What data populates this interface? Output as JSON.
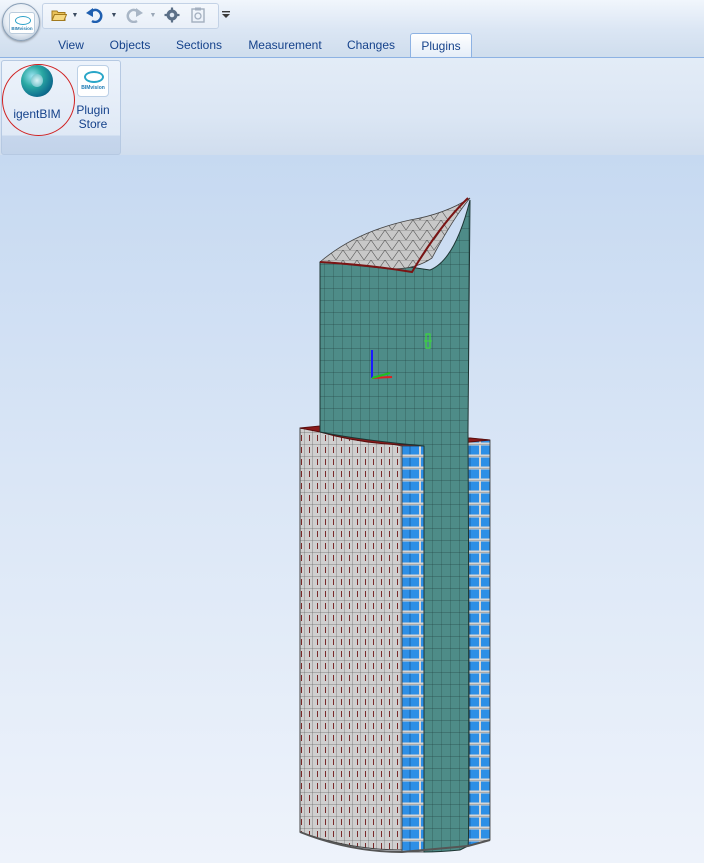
{
  "app": {
    "logo_text": "BIMvision",
    "quick_access": {
      "open_icon": "folder-open-icon",
      "undo_icon": "undo-icon",
      "redo_icon": "redo-icon",
      "settings_icon": "gear-icon",
      "disabled_icon": "clipboard-icon",
      "customize_icon": "chevron-down-icon"
    }
  },
  "tabs": [
    {
      "label": "View"
    },
    {
      "label": "Objects"
    },
    {
      "label": "Sections"
    },
    {
      "label": "Measurement"
    },
    {
      "label": "Changes"
    },
    {
      "label": "Plugins",
      "active": true
    }
  ],
  "ribbon": {
    "igentbim_label": "igentBIM",
    "plugin_store_label_1": "Plugin",
    "plugin_store_label_2": "Store",
    "plugin_store_icon_text": "BIMvision"
  },
  "viewport": {
    "background_top": "#c6d9f1",
    "background_bottom": "#eef3fb",
    "tower_glass": "#4f8f8a",
    "facade_stone": "#c9c9c9",
    "window_blue": "#2f8fe0",
    "slab_red": "#8b1b1b"
  }
}
